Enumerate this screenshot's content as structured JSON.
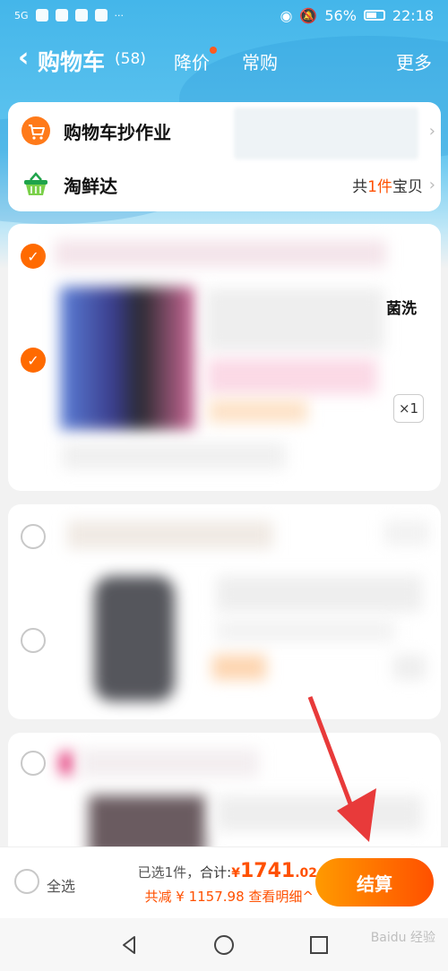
{
  "status_bar": {
    "signal": "5G",
    "battery": "56%",
    "time": "22:18"
  },
  "nav": {
    "back_icon": "chevron-left-icon",
    "title": "购物车",
    "count": "(58)",
    "tab_price_drop": "降价",
    "tab_frequent": "常购",
    "more": "更多"
  },
  "top_card": {
    "homework": {
      "icon": "cart-orange-icon",
      "label": "购物车抄作业"
    },
    "taoxianda": {
      "icon": "basket-green-icon",
      "label": "淘鲜达",
      "summary_prefix": "共",
      "summary_count": "1件",
      "summary_suffix": "宝贝"
    }
  },
  "items": [
    {
      "shop_checked": true,
      "item_checked": true,
      "title_tail": "菌洗",
      "qty": "×1"
    },
    {
      "shop_checked": false,
      "item_checked": false
    },
    {
      "shop_checked": false
    }
  ],
  "bottom_bar": {
    "select_all": "全选",
    "selected_label": "已选1件，",
    "total_label": "合计:",
    "currency": "¥",
    "total_int": "1741",
    "total_dec": ".02",
    "discount_label": "共减",
    "discount_value": "¥ 1157.98",
    "detail_label": "查看明细",
    "detail_icon": "chevron-up-icon",
    "checkout": "结算"
  },
  "watermark": "Baidu 经验",
  "colors": {
    "header_blue": "#44b6ea",
    "accent_orange": "#ff5000",
    "checkout_gradient_start": "#ff9a00"
  }
}
